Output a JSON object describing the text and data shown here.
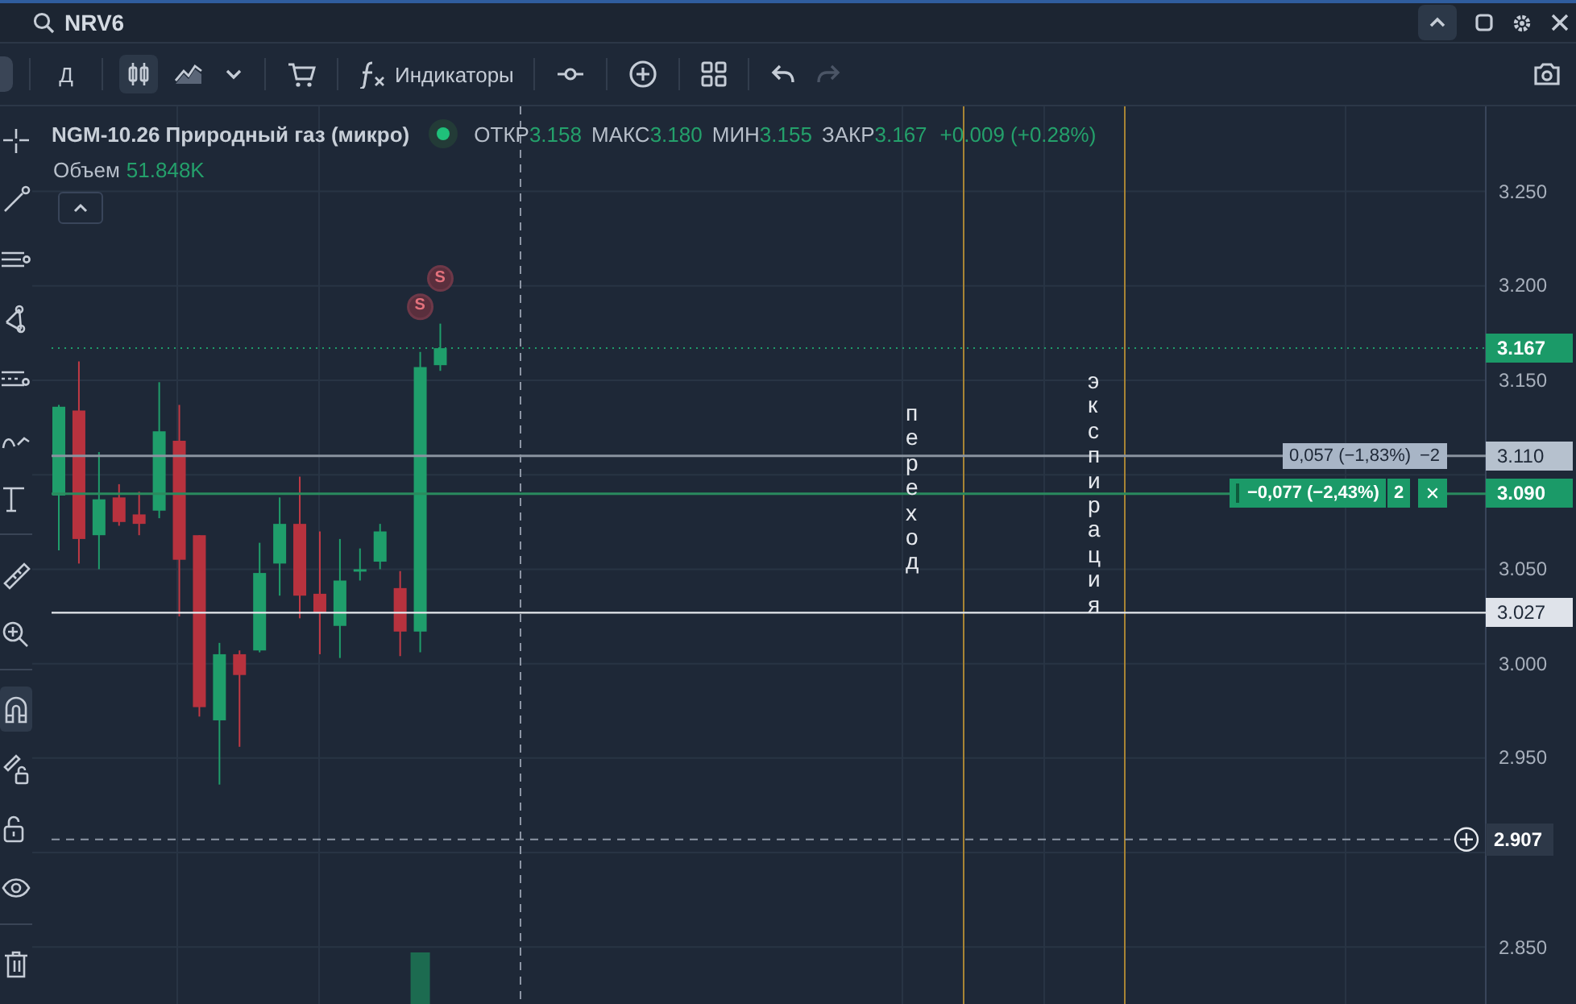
{
  "search": {
    "value": "NRV6"
  },
  "toolbar": {
    "interval": "Д",
    "chart_types": [
      {
        "kind": "candles",
        "selected": true
      },
      {
        "kind": "area",
        "selected": false
      }
    ],
    "indicators_label": "Индикаторы",
    "redo_disabled": true
  },
  "tool_groups": [
    {
      "tools": [
        {
          "kind": "crosshair",
          "selected": false
        },
        {
          "kind": "line",
          "selected": false
        },
        {
          "kind": "lines",
          "selected": false
        },
        {
          "kind": "nodes",
          "selected": false
        },
        {
          "kind": "fib",
          "selected": false
        },
        {
          "kind": "curve",
          "selected": false
        },
        {
          "kind": "text",
          "selected": false
        }
      ]
    },
    {
      "tools": [
        {
          "kind": "ruler",
          "selected": false
        },
        {
          "kind": "zoom",
          "selected": false
        }
      ]
    },
    {
      "tools": [
        {
          "kind": "magnet",
          "selected": true
        },
        {
          "kind": "pencil-lock",
          "selected": false
        },
        {
          "kind": "lock",
          "selected": false
        },
        {
          "kind": "eye",
          "selected": false
        }
      ]
    },
    {
      "tools": [
        {
          "kind": "trash",
          "selected": false
        }
      ]
    }
  ],
  "legend": {
    "symbol": "NGM-10.26 Природный газ (микро)",
    "ohlc": [
      {
        "label": "ОТКР",
        "value": "3.158"
      },
      {
        "label": "МАКС",
        "value": "3.180"
      },
      {
        "label": "МИН",
        "value": "3.155"
      },
      {
        "label": "ЗАКР",
        "value": "3.167"
      }
    ],
    "change": "+0.009 (+0.28%)",
    "volume_label": "Объем",
    "volume_value": "51.848K"
  },
  "chart": {
    "price_axis": {
      "ticks": [
        "3.250",
        "3.200",
        "3.150",
        "3.050",
        "3.000",
        "2.950",
        "2.850"
      ]
    },
    "markers": [
      {
        "text": "S"
      },
      {
        "text": "S"
      }
    ],
    "events": [
      {
        "label": "переход"
      },
      {
        "label": "экспирация"
      }
    ]
  },
  "price_lines": [
    {
      "kind": "last",
      "price": "3.167"
    },
    {
      "kind": "order",
      "price": "3.110",
      "pnl": "0,057 (−1,83%)",
      "qty": "−2"
    },
    {
      "kind": "position",
      "price": "3.090",
      "pnl": "−0,077 (−2,43%)",
      "qty": "2",
      "close": "✕"
    },
    {
      "kind": "level",
      "price": "3.027"
    },
    {
      "kind": "crosshair",
      "price": "2.907"
    }
  ]
}
